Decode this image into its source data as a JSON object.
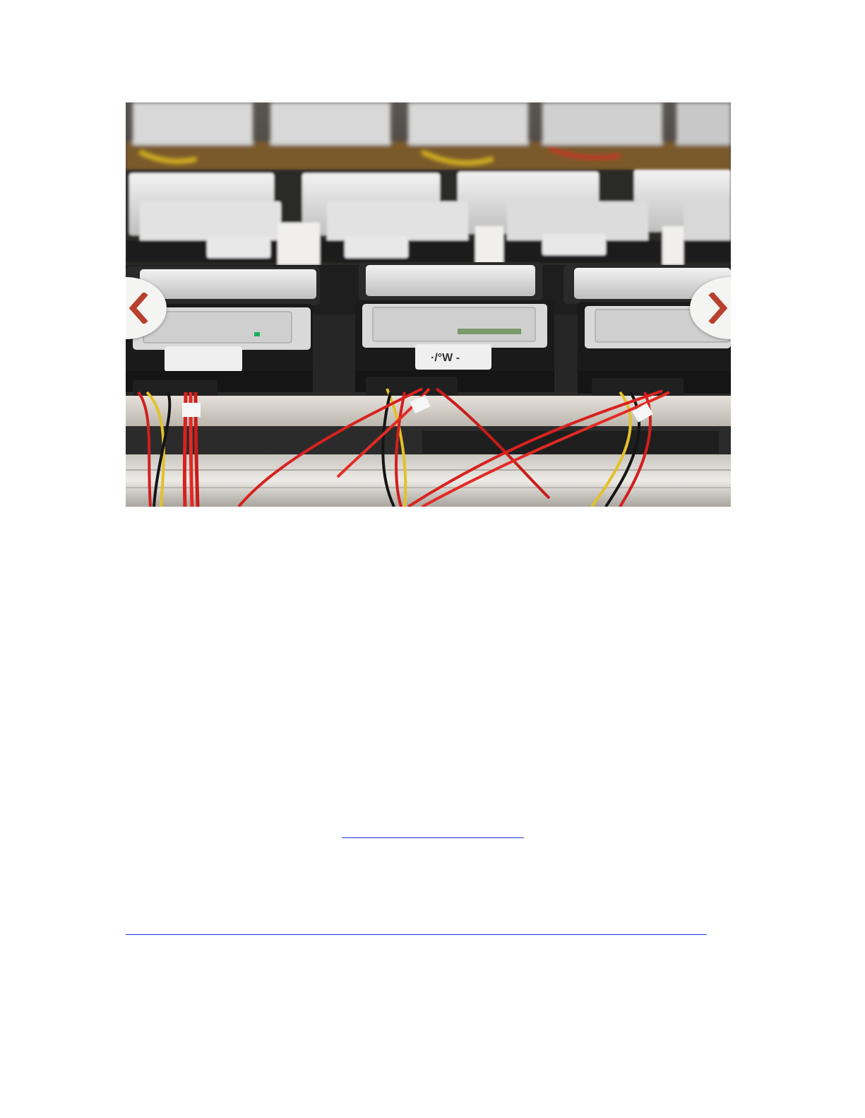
{
  "carousel": {
    "photo_subject": "hard-drives-in-server-rack",
    "prev_icon": "chevron-left-icon",
    "next_icon": "chevron-right-icon",
    "accent_color": "#b7412d"
  },
  "links": {
    "short_link_text": "",
    "long_link_text": "",
    "link_color": "#1a35e0"
  }
}
